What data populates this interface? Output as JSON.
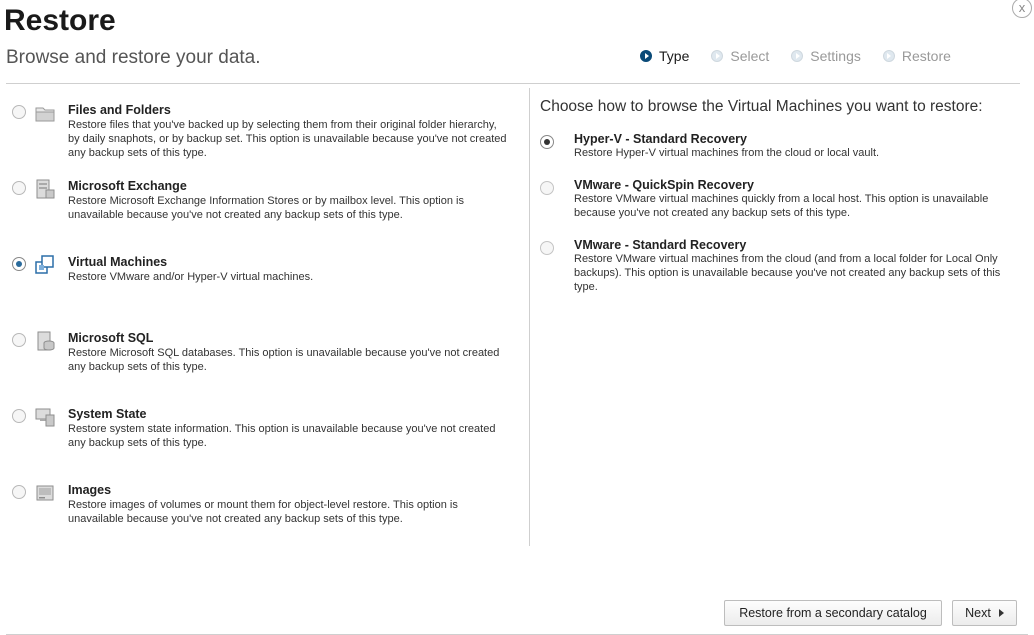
{
  "header": {
    "title": "Restore",
    "subtitle": "Browse and restore your data.",
    "close_label": "x"
  },
  "steps": [
    {
      "label": "Type",
      "active": true
    },
    {
      "label": "Select",
      "active": false
    },
    {
      "label": "Settings",
      "active": false
    },
    {
      "label": "Restore",
      "active": false
    }
  ],
  "restore_types": [
    {
      "name": "Files and Folders",
      "description": "Restore files that you've backed up by selecting them from their original folder hierarchy, by daily snaphots, or by backup set. This option is unavailable because you've not created any backup sets of this type.",
      "selected": false,
      "icon": "folder-icon"
    },
    {
      "name": "Microsoft Exchange",
      "description": "Restore Microsoft Exchange Information Stores or by mailbox level. This option is unavailable because you've not created any backup sets of this type.",
      "selected": false,
      "icon": "exchange-server-icon"
    },
    {
      "name": "Virtual Machines",
      "description": "Restore VMware and/or Hyper-V virtual machines.",
      "selected": true,
      "icon": "virtual-machines-icon"
    },
    {
      "name": "Microsoft SQL",
      "description": "Restore Microsoft SQL databases. This option is unavailable because you've not created any backup sets of this type.",
      "selected": false,
      "icon": "sql-server-icon"
    },
    {
      "name": "System State",
      "description": "Restore system state information. This option is unavailable because you've not created any backup sets of this type.",
      "selected": false,
      "icon": "system-state-icon"
    },
    {
      "name": "Images",
      "description": "Restore images of volumes or mount them for object-level restore. This option is unavailable because you've not created any backup sets of this type.",
      "selected": false,
      "icon": "disk-image-icon"
    }
  ],
  "browse": {
    "heading": "Choose how to browse the Virtual Machines you want to restore:",
    "options": [
      {
        "name": "Hyper-V - Standard Recovery",
        "description": "Restore Hyper-V virtual machines from the cloud or local vault.",
        "selected": true
      },
      {
        "name": "VMware - QuickSpin Recovery",
        "description": "Restore VMware virtual machines quickly from a local host. This option is unavailable because you've not created any backup sets of this type.",
        "selected": false
      },
      {
        "name": "VMware - Standard Recovery",
        "description": "Restore VMware virtual machines from the cloud (and from a local folder for Local Only backups). This option is unavailable because you've not created any backup sets of this type.",
        "selected": false
      }
    ]
  },
  "footer": {
    "secondary_catalog_label": "Restore from a secondary catalog",
    "next_label": "Next"
  }
}
